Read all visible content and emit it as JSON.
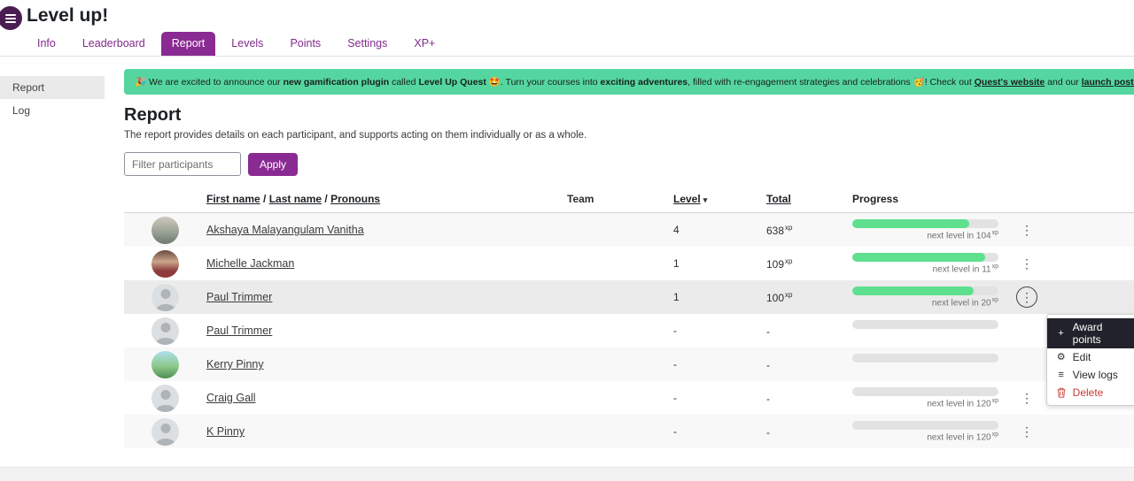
{
  "colors": {
    "accent_purple": "#8a2a93",
    "drawer_purple": "#4b1e53",
    "banner_green": "#55d6a0",
    "progress_green": "#5ee08f",
    "danger_red": "#ca3a31"
  },
  "header": {
    "title": "Level up!"
  },
  "tabs": [
    {
      "label": "Info",
      "active": false
    },
    {
      "label": "Leaderboard",
      "active": false
    },
    {
      "label": "Report",
      "active": true
    },
    {
      "label": "Levels",
      "active": false
    },
    {
      "label": "Points",
      "active": false
    },
    {
      "label": "Settings",
      "active": false
    },
    {
      "label": "XP+",
      "active": false
    }
  ],
  "sidebar": [
    {
      "label": "Report",
      "active": true
    },
    {
      "label": "Log",
      "active": false
    }
  ],
  "banner": {
    "icon": "🎉",
    "segments": [
      "We are excited to announce our ",
      "new gamification plugin",
      " called ",
      "Level Up Quest",
      " 🤩. Turn your courses into ",
      "exciting adventures",
      ", filled with re-engagement strategies and celebrations 🥳! Check out ",
      "Quest's website",
      " and our ",
      "launch post here",
      ". 👈"
    ],
    "close": "×"
  },
  "report": {
    "heading": "Report",
    "description": "The report provides details on each participant, and supports acting on them individually or as a whole.",
    "options_icon": "⋮",
    "filter_placeholder": "Filter participants",
    "apply_label": "Apply"
  },
  "table": {
    "headers": {
      "name_parts": [
        "First name",
        "Last name",
        "Pronouns"
      ],
      "sep": " / ",
      "team": "Team",
      "level": "Level",
      "level_caret": "▾",
      "total": "Total",
      "progress": "Progress"
    },
    "kebab_icon": "⋮",
    "rows": [
      {
        "name": "Akshaya Malayangulam Vanitha",
        "team": "",
        "level": "4",
        "total": "638",
        "total_unit": "xp",
        "progress_pct": 80,
        "next_label": "next level in ",
        "next_value": "104",
        "next_unit": "xp",
        "avatar": "p1"
      },
      {
        "name": "Michelle Jackman",
        "team": "",
        "level": "1",
        "total": "109",
        "total_unit": "xp",
        "progress_pct": 91,
        "next_label": "next level in ",
        "next_value": "11",
        "next_unit": "xp",
        "avatar": "p2"
      },
      {
        "name": "Paul Trimmer",
        "team": "",
        "level": "1",
        "total": "100",
        "total_unit": "xp",
        "progress_pct": 83,
        "next_label": "next level in ",
        "next_value": "20",
        "next_unit": "xp",
        "avatar": "default"
      },
      {
        "name": "Paul Trimmer",
        "team": "",
        "level": "-",
        "total": "-",
        "total_unit": "",
        "progress_pct": 0,
        "next_label": "",
        "next_value": "",
        "next_unit": "",
        "avatar": "default"
      },
      {
        "name": "Kerry Pinny",
        "team": "",
        "level": "-",
        "total": "-",
        "total_unit": "",
        "progress_pct": 0,
        "next_label": "",
        "next_value": "",
        "next_unit": "",
        "avatar": "p5"
      },
      {
        "name": "Craig Gall",
        "team": "",
        "level": "-",
        "total": "-",
        "total_unit": "",
        "progress_pct": 0,
        "next_label": "next level in ",
        "next_value": "120",
        "next_unit": "xp",
        "avatar": "default"
      },
      {
        "name": "K Pinny",
        "team": "",
        "level": "-",
        "total": "-",
        "total_unit": "",
        "progress_pct": 0,
        "next_label": "next level in ",
        "next_value": "120",
        "next_unit": "xp",
        "avatar": "default"
      }
    ]
  },
  "menu": {
    "items": [
      {
        "label": "Award points",
        "icon": "plus-icon",
        "glyph": "+",
        "active": true
      },
      {
        "label": "Edit",
        "icon": "gear-icon",
        "glyph": "⚙",
        "active": false
      },
      {
        "label": "View logs",
        "icon": "list-icon",
        "glyph": "≡",
        "active": false
      },
      {
        "label": "Delete",
        "icon": "trash-icon",
        "glyph": "",
        "active": false,
        "danger": true
      }
    ]
  }
}
